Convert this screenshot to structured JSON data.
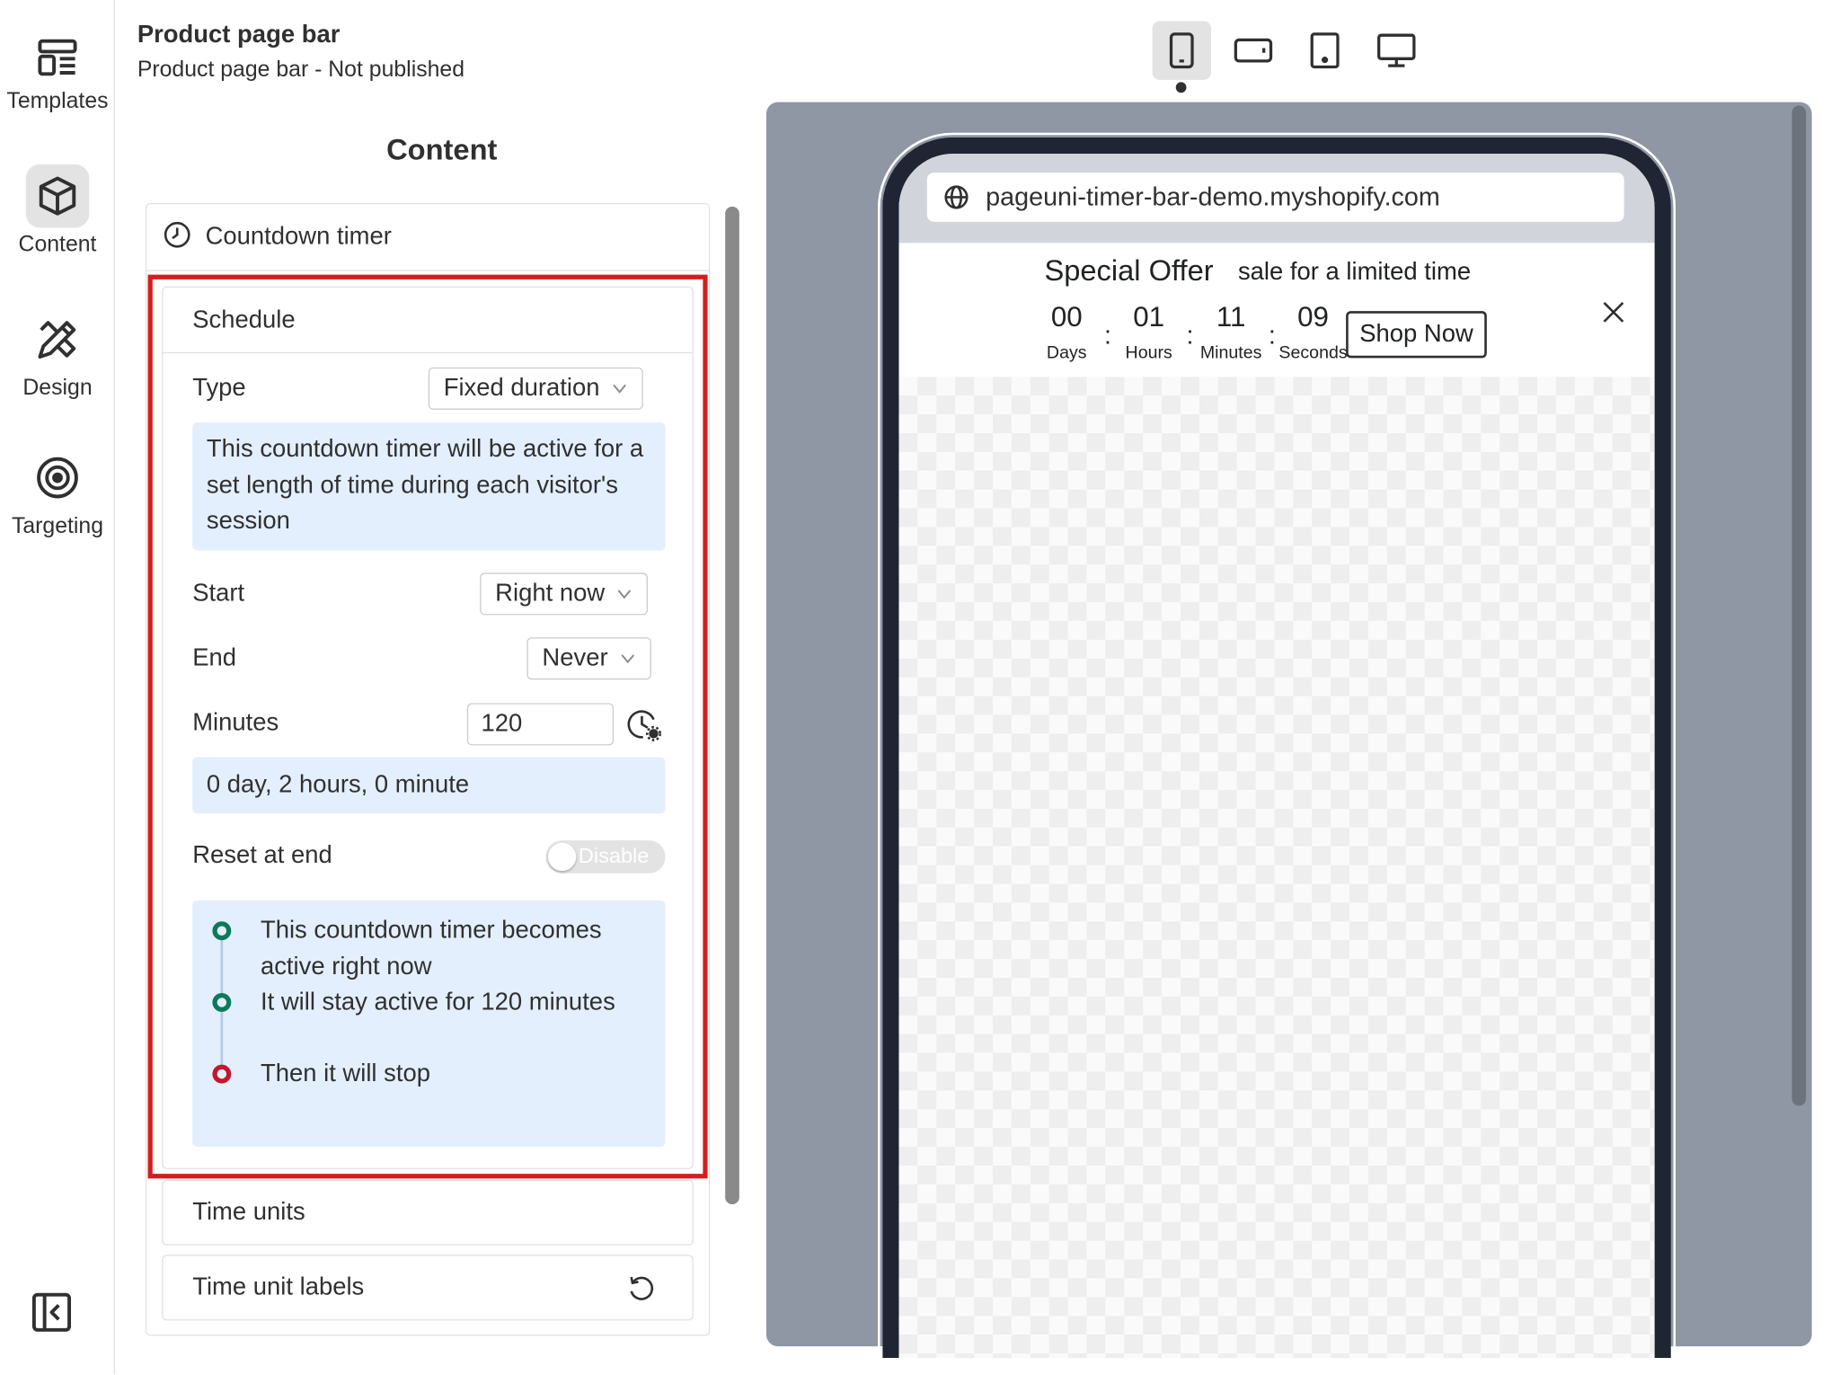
{
  "header": {
    "title": "Product page bar",
    "subtitle": "Product page bar - Not published"
  },
  "rail": {
    "items": [
      {
        "label": "Templates",
        "icon": "templates-icon",
        "active": false
      },
      {
        "label": "Content",
        "icon": "cube-icon",
        "active": true
      },
      {
        "label": "Design",
        "icon": "design-tools-icon",
        "active": false
      },
      {
        "label": "Targeting",
        "icon": "target-icon",
        "active": false
      }
    ]
  },
  "content": {
    "heading": "Content",
    "section_title": "Countdown timer",
    "schedule": {
      "title": "Schedule",
      "type_label": "Type",
      "type_value": "Fixed duration",
      "type_info": "This countdown timer will be active for a set length of time during each visitor's session",
      "start_label": "Start",
      "start_value": "Right now",
      "end_label": "End",
      "end_value": "Never",
      "minutes_label": "Minutes",
      "minutes_value": "120",
      "duration_summary": "0 day, 2 hours, 0 minute",
      "reset_label": "Reset at end",
      "reset_toggle": "Disable",
      "timeline": [
        {
          "text": "This countdown timer becomes active right now",
          "status": "green"
        },
        {
          "text": "It will stay active for 120 minutes",
          "status": "green"
        },
        {
          "text": "Then it will stop",
          "status": "red"
        }
      ]
    },
    "time_units": "Time units",
    "time_unit_labels": "Time unit labels"
  },
  "devices": [
    "mobile",
    "mobile-landscape",
    "tablet",
    "desktop"
  ],
  "preview": {
    "url": "pageuni-timer-bar-demo.myshopify.com",
    "offer_title": "Special Offer",
    "offer_subtitle": "sale for a limited time",
    "countdown": {
      "days": "00",
      "hours": "01",
      "minutes": "11",
      "seconds": "09",
      "days_label": "Days",
      "hours_label": "Hours",
      "minutes_label": "Minutes",
      "seconds_label": "Seconds"
    },
    "button": "Shop Now"
  },
  "colors": {
    "highlight": "#d41e1e",
    "info_bg": "#e3effd",
    "timeline_green": "#0b7a5a",
    "timeline_red": "#c5162e",
    "preview_bg": "#8f97a4"
  }
}
